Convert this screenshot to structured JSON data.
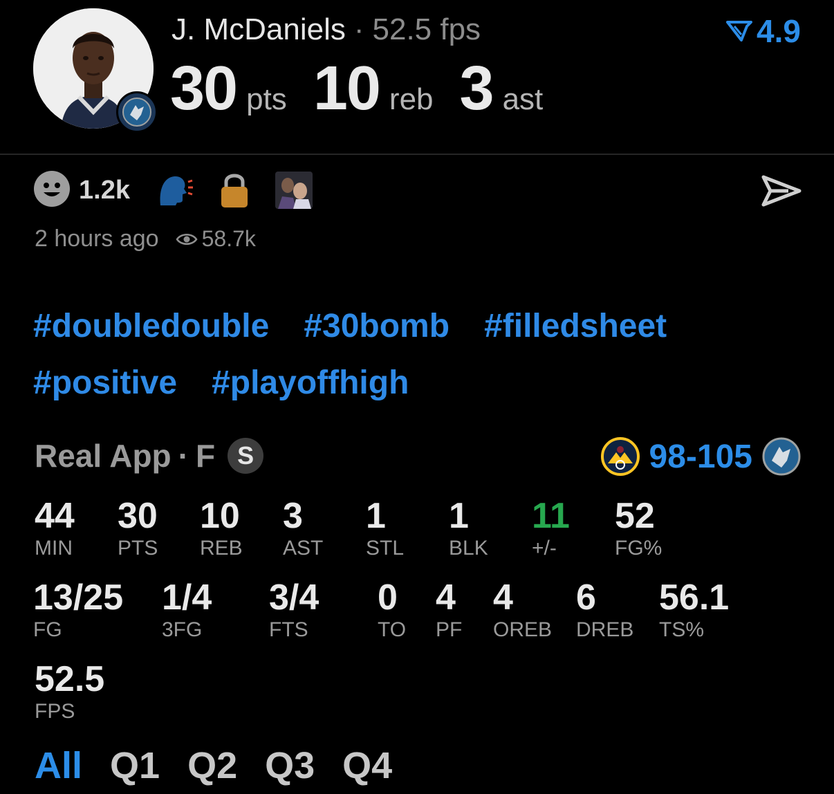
{
  "player": {
    "name": "J. McDaniels",
    "separator": "·",
    "fps_text": "52.5 fps",
    "headline": [
      {
        "value": "30",
        "unit": "pts"
      },
      {
        "value": "10",
        "unit": "reb"
      },
      {
        "value": "3",
        "unit": "ast"
      }
    ]
  },
  "rating": {
    "value": "4.9",
    "icon": "rating-chevron-icon",
    "color": "#2c8de8"
  },
  "reactions": {
    "count": "1.2k",
    "icons": [
      "smiley-icon",
      "speaking-head-icon",
      "lock-icon",
      "reaction-thumbnail"
    ]
  },
  "meta": {
    "time": "2 hours ago",
    "views": "58.7k"
  },
  "hashtags": [
    [
      "#doubledouble",
      "#30bomb",
      "#filledsheet"
    ],
    [
      "#positive",
      "#playoffhigh"
    ]
  ],
  "game": {
    "source": "Real App",
    "separator": "·",
    "status": "F",
    "badge": "S",
    "score": "98-105",
    "home_logo": "nuggets-logo",
    "away_logo": "timberwolves-logo"
  },
  "stats_row1": [
    {
      "value": "44",
      "label": "MIN"
    },
    {
      "value": "30",
      "label": "PTS"
    },
    {
      "value": "10",
      "label": "REB"
    },
    {
      "value": "3",
      "label": "AST"
    },
    {
      "value": "1",
      "label": "STL"
    },
    {
      "value": "1",
      "label": "BLK"
    },
    {
      "value": "11",
      "label": "+/-"
    },
    {
      "value": "52",
      "label": "FG%"
    }
  ],
  "stats_row2": [
    {
      "value": "13/25",
      "label": "FG"
    },
    {
      "value": "1/4",
      "label": "3FG"
    },
    {
      "value": "3/4",
      "label": "FTS"
    },
    {
      "value": "0",
      "label": "TO"
    },
    {
      "value": "4",
      "label": "PF"
    },
    {
      "value": "4",
      "label": "OREB"
    },
    {
      "value": "6",
      "label": "DREB"
    },
    {
      "value": "56.1",
      "label": "TS%"
    }
  ],
  "stats_row3": [
    {
      "value": "52.5",
      "label": "FPS"
    }
  ],
  "quarters": [
    "All",
    "Q1",
    "Q2",
    "Q3",
    "Q4"
  ],
  "active_quarter": "All",
  "colors": {
    "accent": "#2c8de8",
    "positive": "#27a84f",
    "background": "#000000"
  }
}
